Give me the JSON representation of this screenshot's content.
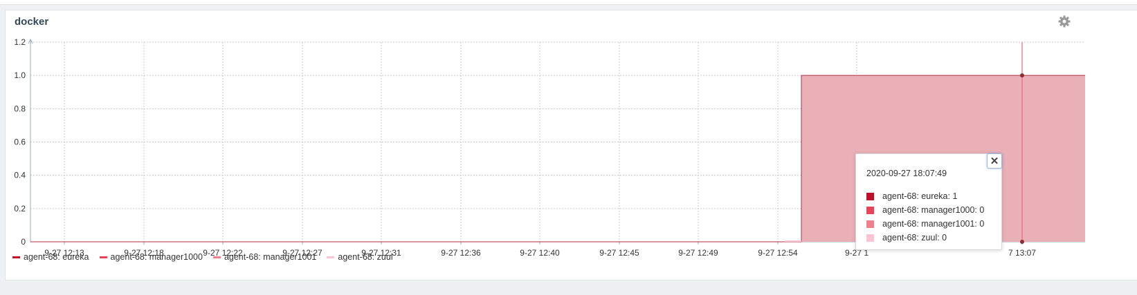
{
  "panel": {
    "title": "docker",
    "settings_icon": "gear-icon"
  },
  "chart_data": {
    "type": "area",
    "title": "docker",
    "x": [
      "9-27 12:13",
      "9-27 12:18",
      "9-27 12:22",
      "9-27 12:27",
      "9-27 12:31",
      "9-27 12:36",
      "9-27 12:40",
      "9-27 12:45",
      "9-27 12:49",
      "9-27 12:54",
      "9-27 1",
      "9-27 13:07"
    ],
    "ylim": [
      0,
      1.2
    ],
    "yticks": [
      "0",
      "0.2",
      "0.4",
      "0.6",
      "0.8",
      "1.0",
      "1.2"
    ],
    "xticks": [
      "9-27 12:13",
      "9-27 12:18",
      "9-27 12:22",
      "9-27 12:27",
      "9-27 12:31",
      "9-27 12:36",
      "9-27 12:40",
      "9-27 12:45",
      "9-27 12:49",
      "9-27 12:54",
      "9-27 1",
      "7 13:07"
    ],
    "grid": true,
    "legend_position": "bottom-left",
    "series": [
      {
        "name": "agent-68: eureka",
        "color": "#c0102b",
        "values": [
          0,
          0,
          0,
          0,
          0,
          0,
          0,
          0,
          0,
          0,
          1,
          1
        ]
      },
      {
        "name": "agent-68: manager1000",
        "color": "#e8435a",
        "values": [
          0,
          0,
          0,
          0,
          0,
          0,
          0,
          0,
          0,
          0,
          0,
          0
        ]
      },
      {
        "name": "agent-68: manager1001",
        "color": "#f0808e",
        "values": [
          0,
          0,
          0,
          0,
          0,
          0,
          0,
          0,
          0,
          0,
          0,
          0
        ]
      },
      {
        "name": "agent-68: zuul",
        "color": "#fbc4d2",
        "values": [
          0,
          0,
          0,
          0,
          0,
          0,
          0,
          0,
          0,
          0,
          0,
          0
        ]
      }
    ],
    "step_start": "9-27 12:58",
    "fill_color": "#eab0b8",
    "line_color": "#b0303f"
  },
  "tooltip": {
    "time": "2020-09-27 18:07:49",
    "close_icon": "close-icon",
    "rows": [
      {
        "label": "agent-68: eureka: 1",
        "color": "#c0102b"
      },
      {
        "label": "agent-68: manager1000: 0",
        "color": "#e8435a"
      },
      {
        "label": "agent-68: manager1001: 0",
        "color": "#f0808e"
      },
      {
        "label": "agent-68: zuul: 0",
        "color": "#fbc4d2"
      }
    ]
  }
}
